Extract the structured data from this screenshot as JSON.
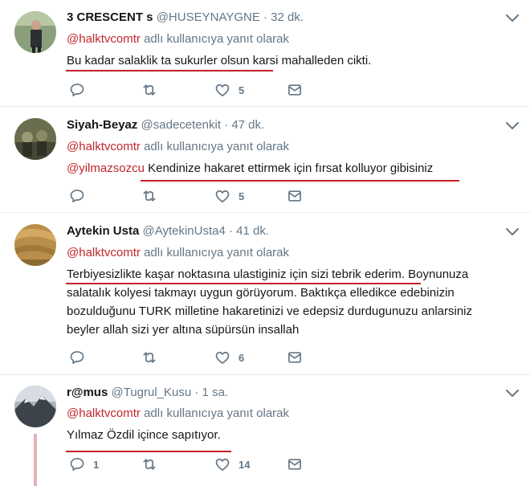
{
  "common": {
    "replying_suffix": "adlı kullanıcıya yanıt olarak",
    "replying_mention": "@halktvcomtr"
  },
  "tweets": [
    {
      "name": "3 CRESCENT s",
      "handle": "@HUSEYNAYGNE",
      "time": "· 32 dk.",
      "text": "Bu kadar salaklik ta sukurler olsun karsi mahalleden cikti.",
      "reply_count": "",
      "retweet_count": "",
      "like_count": "5"
    },
    {
      "name": "Siyah-Beyaz",
      "handle": "@sadecetenkit",
      "time": "· 47 dk.",
      "text_mention": "@yilmazsozcu",
      "text": "Kendinize hakaret ettirmek için fırsat kolluyor gibisiniz",
      "reply_count": "",
      "retweet_count": "",
      "like_count": "5"
    },
    {
      "name": "Aytekin Usta",
      "handle": "@AytekinUsta4",
      "time": "· 41 dk.",
      "text_lines": [
        "Terbiyesizlikte kaşar noktasına ulastiginiz için sizi tebrik ederim. Boynunuza",
        "salatalık kolyesi takmayı uygun görüyorum. Baktıkça elledikce edebinizin",
        "bozulduğunu TURK milletine hakaretinizi ve edepsiz durdugunuzu anlarsiniz",
        "beyler allah sizi yer altına süpürsün insallah"
      ],
      "reply_count": "",
      "retweet_count": "",
      "like_count": "6"
    },
    {
      "name": "r@mus",
      "handle": "@Tugrul_Kusu",
      "time": "· 1 sa.",
      "text": "Yılmaz Özdil içince sapıtıyor.",
      "reply_count": "1",
      "retweet_count": "",
      "like_count": "14"
    }
  ],
  "colors": {
    "text": "#14171a",
    "muted": "#657786",
    "mention": "#c1272d",
    "annotation_underline": "#c7202a",
    "thread_line": "#e5b1b6"
  },
  "icons": [
    "chevron-down-icon",
    "reply-icon",
    "retweet-icon",
    "like-icon",
    "message-icon"
  ]
}
